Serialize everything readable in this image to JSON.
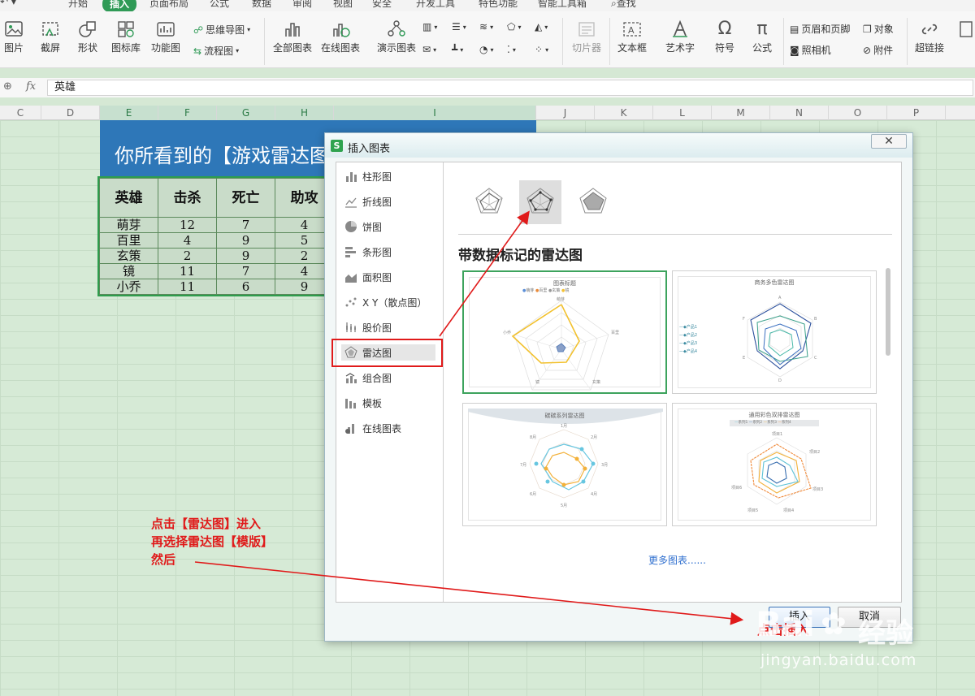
{
  "ribbon": {
    "tabs": [
      "开始",
      "插入",
      "页面布局",
      "公式",
      "数据",
      "审阅",
      "视图",
      "安全",
      "开发工具",
      "特色功能",
      "智能工具箱",
      "查找"
    ],
    "active_tab": "插入",
    "buttons": {
      "picture": "图片",
      "screenshot": "截屏",
      "shape": "形状",
      "icon_lib": "图标库",
      "func_chart": "功能图",
      "mindmap": "思维导图",
      "flowchart": "流程图",
      "all_charts": "全部图表",
      "online_charts": "在线图表",
      "demo_charts": "演示图表",
      "slicer": "切片器",
      "textbox": "文本框",
      "wordart": "艺术字",
      "symbol": "符号",
      "formula": "公式",
      "header_footer": "页眉和页脚",
      "object": "对象",
      "camera": "照相机",
      "attachment": "附件",
      "hyperlink": "超链接"
    },
    "accent": "#2f9a56"
  },
  "formula_bar": {
    "fx_label": "fx",
    "value": "英雄"
  },
  "columns": [
    "C",
    "D",
    "E",
    "F",
    "G",
    "H",
    "I",
    "J",
    "K",
    "L",
    "M",
    "N",
    "O",
    "P"
  ],
  "sheet": {
    "banner": "你所看到的【游戏雷达图】是怎么来的？",
    "banner_color": "#2e77b8",
    "headers": [
      "英雄",
      "击杀",
      "死亡",
      "助攻"
    ],
    "rows": [
      [
        "萌芽",
        "12",
        "7",
        "4"
      ],
      [
        "百里",
        "4",
        "9",
        "5"
      ],
      [
        "玄策",
        "2",
        "9",
        "2"
      ],
      [
        "镜",
        "11",
        "7",
        "4"
      ],
      [
        "小乔",
        "11",
        "6",
        "9"
      ]
    ]
  },
  "dialog": {
    "title": "插入图表",
    "close_symbol": "✕",
    "categories": [
      "柱形图",
      "折线图",
      "饼图",
      "条形图",
      "面积图",
      "X Y（散点图）",
      "股价图",
      "雷达图",
      "组合图",
      "模板",
      "在线图表"
    ],
    "selected_category": "雷达图",
    "heading": "带数据标记的雷达图",
    "templates": [
      {
        "title": "图表标题",
        "legend": [
          "萌芽",
          "百里",
          "玄策",
          "镜"
        ],
        "axes": [
          "萌芽",
          "百里",
          "玄策",
          "镜",
          "小乔"
        ]
      },
      {
        "title": "商务多色雷达图",
        "legend": [
          "产品1",
          "产品2",
          "产品3",
          "产品4"
        ],
        "axes": [
          "A",
          "B",
          "C",
          "D",
          "E",
          "F"
        ]
      },
      {
        "title": "碳碳系列雷达图",
        "legend": [],
        "axes": [
          "1月",
          "2月",
          "3月",
          "4月",
          "5月",
          "6月",
          "7月",
          "8月"
        ]
      },
      {
        "title": "通用彩色双排雷达图",
        "legend": [
          "系列1",
          "系列2",
          "系列3",
          "系列4"
        ],
        "axes": [
          "项目1",
          "项目2",
          "项目3",
          "项目4",
          "项目5",
          "项目6"
        ]
      }
    ],
    "more_link": "更多图表......",
    "insert_button": "插入",
    "cancel_button": "取消"
  },
  "annotations": {
    "instruction_lines": [
      "点击【雷达图】进入",
      "再选择雷达图【模版】",
      "然后"
    ],
    "insert_callout": "点击插入",
    "color": "#e01a1a"
  },
  "watermark": {
    "logo": "Bai",
    "brand": "经验",
    "url": "jingyan.baidu.com"
  }
}
